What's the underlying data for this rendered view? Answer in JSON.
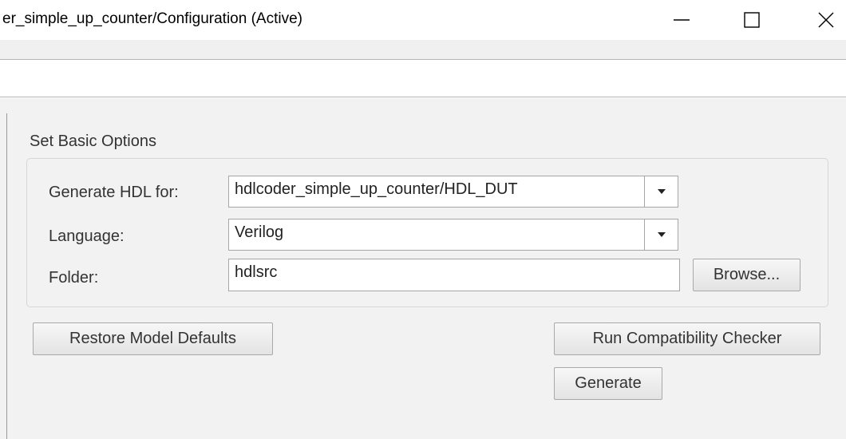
{
  "window": {
    "title": "er_simple_up_counter/Configuration (Active)",
    "controls": [
      "minimize-icon",
      "maximize-icon",
      "close-icon"
    ]
  },
  "section": {
    "heading": "Set Basic Options"
  },
  "form": {
    "generate_hdl_for": {
      "label": "Generate HDL for:",
      "value": "hdlcoder_simple_up_counter/HDL_DUT",
      "icon": "chevron-down-icon"
    },
    "language": {
      "label": "Language:",
      "value": "Verilog",
      "icon": "chevron-down-icon"
    },
    "folder": {
      "label": "Folder:",
      "value": "hdlsrc",
      "browse_label": "Browse..."
    }
  },
  "buttons": {
    "restore_defaults": "Restore Model Defaults",
    "compat_checker": "Run Compatibility Checker",
    "generate": "Generate"
  }
}
